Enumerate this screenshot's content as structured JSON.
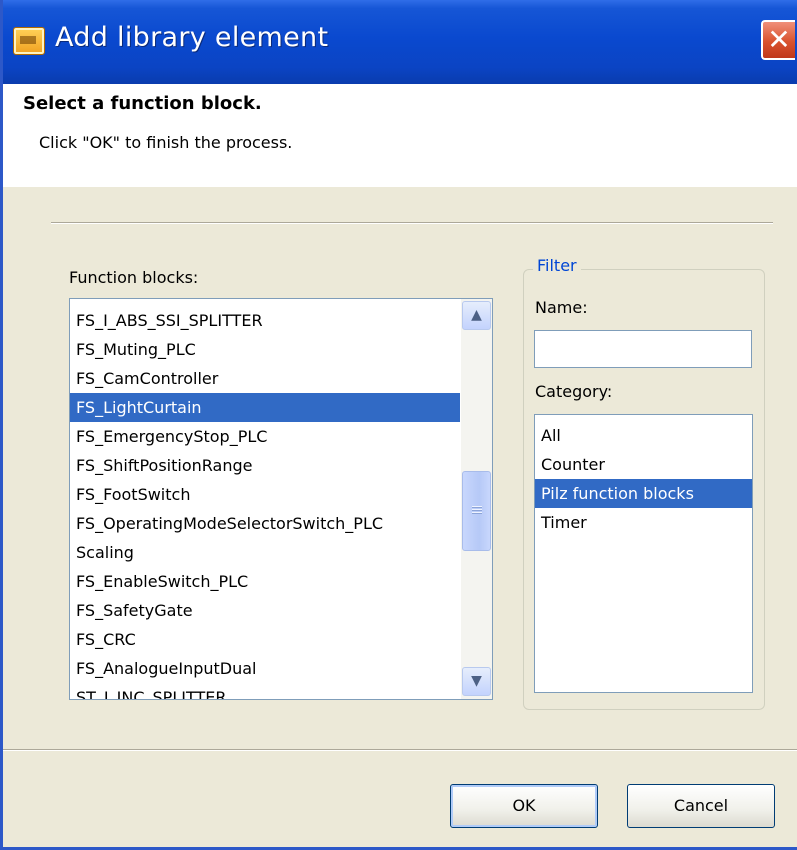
{
  "window": {
    "title": "Add library element",
    "icon": "library-app-icon",
    "close_label": "✕"
  },
  "header": {
    "title": "Select a function block.",
    "description": "Click \"OK\" to finish the process."
  },
  "function_blocks": {
    "label": "Function blocks:",
    "items": [
      "FS_I_ABS_SSI_SPLITTER",
      "FS_Muting_PLC",
      "FS_CamController",
      "FS_LightCurtain",
      "FS_EmergencyStop_PLC",
      "FS_ShiftPositionRange",
      "FS_FootSwitch",
      "FS_OperatingModeSelectorSwitch_PLC",
      "Scaling",
      "FS_EnableSwitch_PLC",
      "FS_SafetyGate",
      "FS_CRC",
      "FS_AnalogueInputDual",
      "ST_I_INC_SPLITTER"
    ],
    "selected": "FS_LightCurtain",
    "scroll_up_glyph": "▲",
    "scroll_down_glyph": "▼"
  },
  "filter": {
    "legend": "Filter",
    "name_label": "Name:",
    "name_value": "",
    "category_label": "Category:",
    "categories": [
      "All",
      "Counter",
      "Pilz function blocks",
      "Timer"
    ],
    "selected_category": "Pilz function blocks"
  },
  "buttons": {
    "ok_label": "OK",
    "cancel_label": "Cancel"
  },
  "colors": {
    "titlebar": "#0a49cf",
    "selection": "#316ac5",
    "dialog_bg": "#ece9d8",
    "filter_legend": "#0046d5"
  }
}
